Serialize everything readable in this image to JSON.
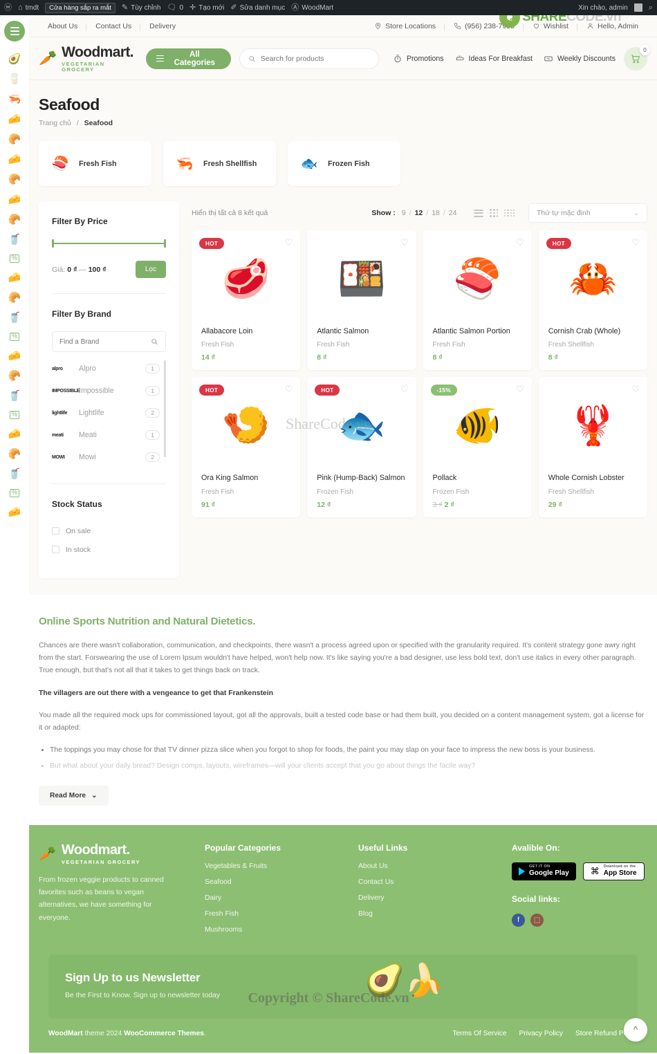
{
  "admin_bar": {
    "wp_icon": "wordpress-icon",
    "site_icon": "home-icon",
    "site_name": "tmdt",
    "coming_soon_pill": "Cửa hàng sắp ra mắt",
    "customize": "Tùy chỉnh",
    "comments_count": "0",
    "new": "Tạo mới",
    "edit_category": "Sửa danh mục",
    "theme": "WoodMart",
    "greeting": "Xin chào, admin"
  },
  "watermark": {
    "brand_a": "SHARE",
    "brand_b": "CODE.vn",
    "center": "ShareCode.vn",
    "copyright": "Copyright © ShareCode.vn"
  },
  "rail": {
    "menu_icon": "hamburger-menu-icon",
    "icons": [
      "avocado-icon",
      "milk-icon",
      "shrimp-icon",
      "cheese-icon",
      "croissant-icon",
      "cheese-icon",
      "croissant-icon",
      "cheese-icon",
      "croissant-icon",
      "drink-icon",
      "sale-tag-icon",
      "cheese-icon",
      "croissant-icon",
      "drink-icon",
      "sale-tag-icon",
      "cheese-icon",
      "croissant-icon",
      "drink-icon",
      "sale-tag-icon",
      "cheese-icon",
      "croissant-icon",
      "drink-icon",
      "sale-tag-icon"
    ]
  },
  "topbar": {
    "left_links": [
      "About Us",
      "Contact Us",
      "Delivery"
    ],
    "store_locations": "Store Locations",
    "phone": "(956) 238-7908",
    "wishlist": "Wishlist",
    "account": "Hello, Admin"
  },
  "header": {
    "brand_name": "Woodmart.",
    "brand_tagline": "VEGETARIAN GROCERY",
    "all_categories": "All Categories",
    "search_placeholder": "Search for products",
    "search_value": "",
    "nav": [
      {
        "label": "Promotions",
        "icon": "promo-icon"
      },
      {
        "label": "Ideas For Breakfast",
        "icon": "breakfast-icon"
      },
      {
        "label": "Weekly Discounts",
        "icon": "discount-ticket-icon"
      }
    ],
    "cart_count": "0"
  },
  "page": {
    "title": "Seafood",
    "breadcrumb_home": "Trang chủ",
    "breadcrumb_sep": "/",
    "breadcrumb_current": "Seafood"
  },
  "categories": [
    {
      "name": "Fresh Fish",
      "thumb": "🍣"
    },
    {
      "name": "Fresh Shellfish",
      "thumb": "🦐"
    },
    {
      "name": "Frozen Fish",
      "thumb": "🐟"
    }
  ],
  "sidebar": {
    "price": {
      "title": "Filter By Price",
      "label": "Giá:",
      "min": "0 ₫",
      "dash": "—",
      "max": "100 ₫",
      "button": "Lọc"
    },
    "brand": {
      "title": "Filter By Brand",
      "search_placeholder": "Find a Brand",
      "items": [
        {
          "logo": "alpro",
          "name": "Alpro",
          "count": "1"
        },
        {
          "logo": "IMPOSSIBLE",
          "name": "Impossible",
          "count": "1"
        },
        {
          "logo": "lightlife",
          "name": "Lightlife",
          "count": "2"
        },
        {
          "logo": "meati",
          "name": "Meati",
          "count": "1"
        },
        {
          "logo": "MOWI",
          "name": "Mowi",
          "count": "2"
        }
      ]
    },
    "stock": {
      "title": "Stock Status",
      "options": [
        "On sale",
        "In stock"
      ]
    }
  },
  "toolbar": {
    "results": "Hiển thị tất cả 8 kết quả",
    "show_label": "Show :",
    "show_options": [
      "9",
      "12",
      "18",
      "24"
    ],
    "show_active": "12",
    "views": [
      "list-view-icon",
      "grid-3-view-icon",
      "grid-4-view-icon"
    ],
    "sort_value": "Thứ tự mặc định"
  },
  "products": [
    {
      "badge": "HOT",
      "badge_type": "hot",
      "img": "🥩",
      "name": "Allabacore Loin",
      "category": "Fresh Fish",
      "price": "14 ₫",
      "old_price": ""
    },
    {
      "badge": "",
      "badge_type": "",
      "img": "🍱",
      "name": "Atlantic Salmon",
      "category": "Fresh Fish",
      "price": "8 ₫",
      "old_price": ""
    },
    {
      "badge": "",
      "badge_type": "",
      "img": "🍣",
      "name": "Atlantic Salmon Portion",
      "category": "Fresh Fish",
      "price": "8 ₫",
      "old_price": ""
    },
    {
      "badge": "HOT",
      "badge_type": "hot",
      "img": "🦀",
      "name": "Cornish Crab (Whole)",
      "category": "Fresh Shellfish",
      "price": "8 ₫",
      "old_price": ""
    },
    {
      "badge": "HOT",
      "badge_type": "hot",
      "img": "🍤",
      "name": "Ora King Salmon",
      "category": "Fresh Fish",
      "price": "91 ₫",
      "old_price": ""
    },
    {
      "badge": "HOT",
      "badge_type": "hot",
      "img": "🐟",
      "name": "Pink (Hump-Back) Salmon",
      "category": "Frozen Fish",
      "price": "12 ₫",
      "old_price": ""
    },
    {
      "badge": "-15%",
      "badge_type": "sale",
      "img": "🐠",
      "name": "Pollack",
      "category": "Frozen Fish",
      "price": "2 ₫",
      "old_price": "3 ₫"
    },
    {
      "badge": "",
      "badge_type": "",
      "img": "🦞",
      "name": "Whole Cornish Lobster",
      "category": "Fresh Shellfish",
      "price": "29 ₫",
      "old_price": ""
    }
  ],
  "description": {
    "heading": "Online Sports Nutrition and Natural Dietetics.",
    "p1": "Chances are there wasn't collaboration, communication, and checkpoints, there wasn't a process agreed upon or specified with the granularity required. It's content strategy gone awry right from the start. Forswearing the use of Lorem Ipsum wouldn't have helped, won't help now. It's like saying you're a bad designer, use less bold text, don't use italics in every other paragraph. True enough, but that's not all that it takes to get things back on track.",
    "p2": "The villagers are out there with a vengeance to get that Frankenstein",
    "p3": "You made all the required mock ups for commissioned layout, got all the approvals, built a tested code base or had them built, you decided on a content management system, got a license for it or adapted:",
    "bullets": [
      "The toppings you may chose for that TV dinner pizza slice when you forgot to shop for foods, the paint you may slap on your face to impress the new boss is your business.",
      "But what about your daily bread? Design comps, layouts, wireframes—will your clients accept that you go about things the facile way?"
    ],
    "read_more": "Read More"
  },
  "footer": {
    "brand_name": "Woodmart.",
    "brand_tagline": "VEGETARIAN GROCERY",
    "about": "From frozen veggie products to canned favorites such as beans to vegan alternatives, we have something for everyone.",
    "popular": {
      "title": "Popular Categories",
      "links": [
        "Vegetables & Fruits",
        "Seafood",
        "Dairy",
        "Fresh Fish",
        "Mushrooms"
      ]
    },
    "useful": {
      "title": "Useful Links",
      "links": [
        "About Us",
        "Contact Us",
        "Delivery",
        "Blog"
      ]
    },
    "available": {
      "title": "Avalible On:",
      "google_play_small": "GET IT ON",
      "google_play_big": "Google Play",
      "app_store_small": "Download on the",
      "app_store_big": "App Store"
    },
    "social": {
      "title": "Social links:",
      "items": [
        "facebook-icon",
        "instagram-icon"
      ]
    },
    "newsletter": {
      "title": "Sign Up to us Newsletter",
      "subtitle": "Be the First to Know. Sign up to newsletter today"
    },
    "bottom": {
      "copy_strong": "WoodMart",
      "copy_rest": " theme 2024 ",
      "copy_strong2": "WooCommerce Themes",
      "copy_end": ".",
      "links": [
        "Terms Of Service",
        "Privacy Policy",
        "Store Refund Policy"
      ]
    },
    "to_top": "scroll-to-top-icon"
  },
  "colors": {
    "brand_green": "#7fb069",
    "footer_green": "#8cbf72",
    "hot_red": "#dc3545",
    "admin_dark": "#1d2327"
  }
}
